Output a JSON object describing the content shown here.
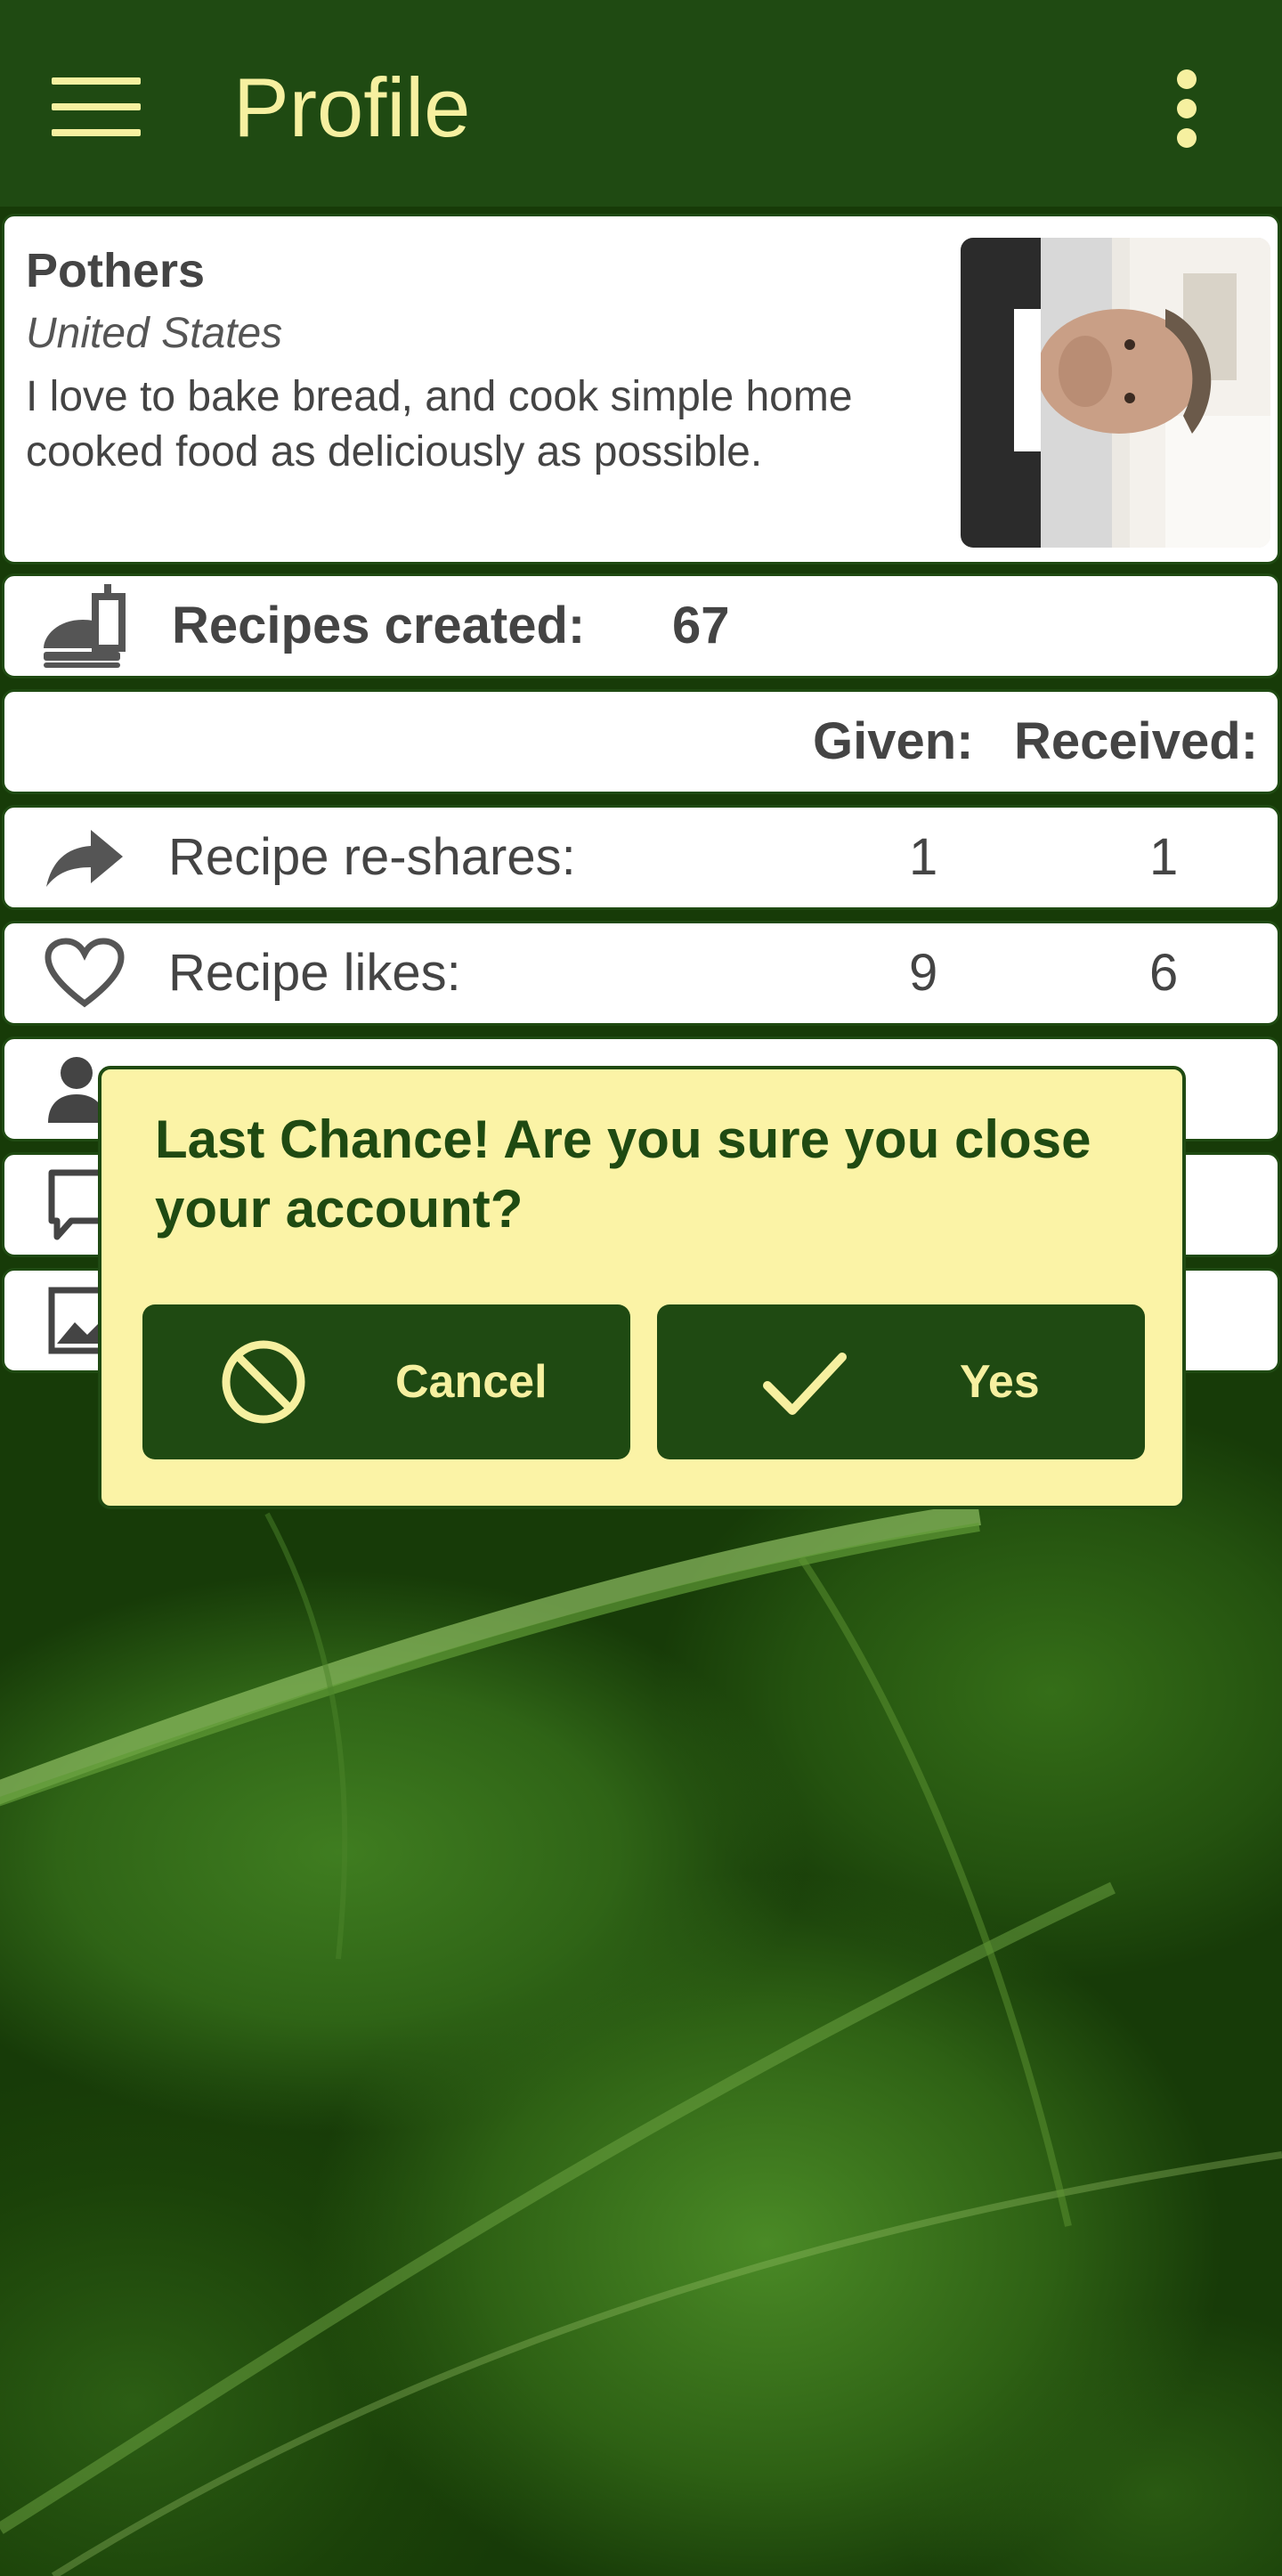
{
  "app_bar": {
    "title": "Profile",
    "menu_icon": "hamburger-menu-icon",
    "overflow_icon": "more-vert-icon",
    "background_color": "#1f4a12",
    "text_color": "#f6f0a0"
  },
  "profile": {
    "name": "Pothers",
    "country": "United States",
    "bio": "I love to bake bread, and cook simple home cooked food as deliciously as possible."
  },
  "stats": {
    "recipes_created_label": "Recipes created:",
    "recipes_created_value": "67",
    "header_given": "Given:",
    "header_received": "Received:",
    "reshares": {
      "label": "Recipe re-shares:",
      "given": "1",
      "received": "1",
      "icon": "share-icon"
    },
    "likes": {
      "label": "Recipe likes:",
      "given": "9",
      "received": "6",
      "icon": "heart-icon"
    },
    "hidden_row_icons": [
      "person-icon",
      "comment-icon",
      "image-icon"
    ]
  },
  "dialog": {
    "message": "Last Chance! Are you sure you close your account?",
    "cancel_label": "Cancel",
    "cancel_icon": "block-icon",
    "confirm_label": "Yes",
    "confirm_icon": "check-icon",
    "background_color": "#fbf3a6",
    "accent_color": "#1f4a12"
  }
}
